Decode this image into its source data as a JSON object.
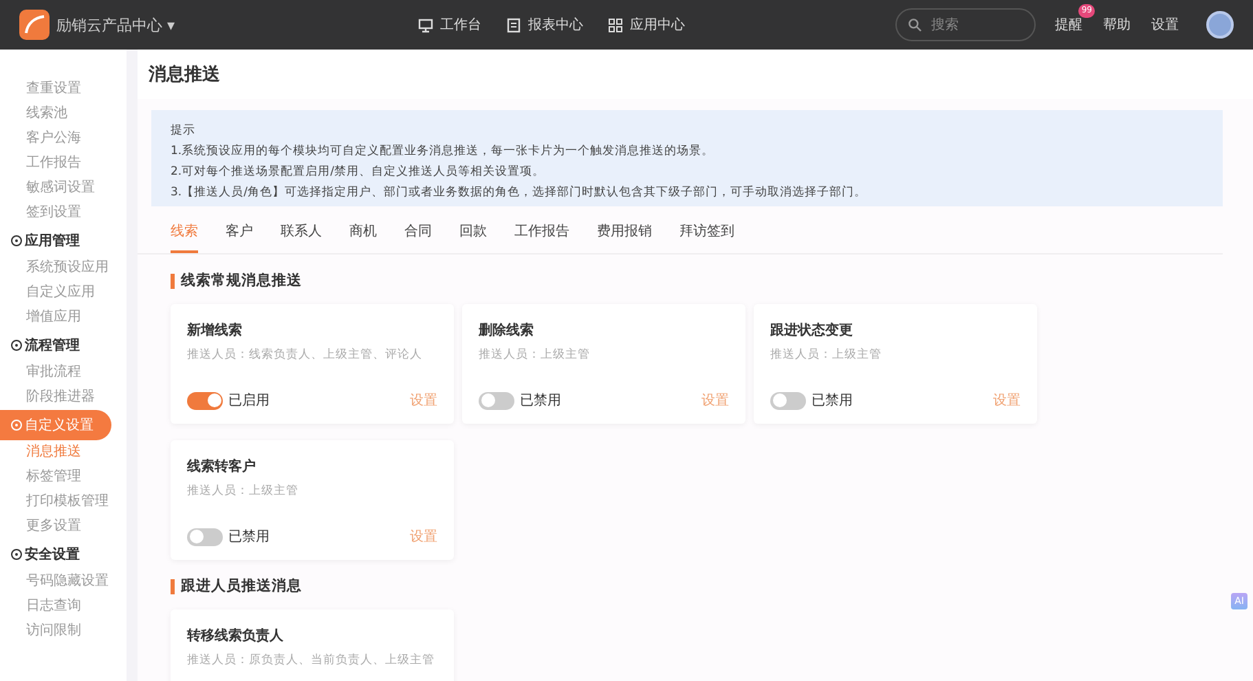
{
  "brand": {
    "name": "励销云产品中心",
    "caret": "▾"
  },
  "nav": [
    {
      "label": "工作台",
      "kind": "monitor"
    },
    {
      "label": "报表中心",
      "kind": "report"
    },
    {
      "label": "应用中心",
      "kind": "grid"
    }
  ],
  "search": {
    "placeholder": "搜索"
  },
  "header_links": [
    {
      "label": "提醒",
      "badge": "99"
    },
    {
      "label": "帮助"
    },
    {
      "label": "设置"
    }
  ],
  "sidebar": {
    "groups": [
      {
        "children": [
          {
            "label": "查重设置",
            "selected": false
          },
          {
            "label": "线索池",
            "selected": false
          },
          {
            "label": "客户公海",
            "selected": false
          },
          {
            "label": "工作报告",
            "selected": false
          },
          {
            "label": "敏感词设置",
            "selected": false
          },
          {
            "label": "签到设置",
            "selected": false
          }
        ]
      },
      {
        "label": "应用管理",
        "selected": false,
        "children": [
          {
            "label": "系统预设应用",
            "selected": false
          },
          {
            "label": "自定义应用",
            "selected": false
          },
          {
            "label": "增值应用",
            "selected": false
          }
        ]
      },
      {
        "label": "流程管理",
        "selected": false,
        "children": [
          {
            "label": "审批流程",
            "selected": false
          },
          {
            "label": "阶段推进器",
            "selected": false
          }
        ]
      },
      {
        "label": "自定义设置",
        "selected": true,
        "children": [
          {
            "label": "消息推送",
            "selected": true
          },
          {
            "label": "标签管理",
            "selected": false
          },
          {
            "label": "打印模板管理",
            "selected": false
          },
          {
            "label": "更多设置",
            "selected": false
          }
        ]
      },
      {
        "label": "安全设置",
        "selected": false,
        "children": [
          {
            "label": "号码隐藏设置",
            "selected": false
          },
          {
            "label": "日志查询",
            "selected": false
          },
          {
            "label": "访问限制",
            "selected": false
          }
        ]
      }
    ]
  },
  "page_title": "消息推送",
  "tip": {
    "title": "提示",
    "lines": [
      "1.系统预设应用的每个模块均可自定义配置业务消息推送，每一张卡片为一个触发消息推送的场景。",
      "2.可对每个推送场景配置启用/禁用、自定义推送人员等相关设置项。",
      "3.【推送人员/角色】可选择指定用户、部门或者业务数据的角色，选择部门时默认包含其下级子部门，可手动取消选择子部门。"
    ]
  },
  "tabs": [
    {
      "label": "线索",
      "selected": true
    },
    {
      "label": "客户",
      "selected": false
    },
    {
      "label": "联系人",
      "selected": false
    },
    {
      "label": "商机",
      "selected": false
    },
    {
      "label": "合同",
      "selected": false
    },
    {
      "label": "回款",
      "selected": false
    },
    {
      "label": "工作报告",
      "selected": false
    },
    {
      "label": "费用报销",
      "selected": false
    },
    {
      "label": "拜访签到",
      "selected": false
    }
  ],
  "sections": [
    {
      "title": "线索常规消息推送",
      "cards": [
        {
          "title": "新增线索",
          "recipients": "推送人员：线索负责人、上级主管、评论人",
          "on": true,
          "status": "已启用",
          "action": "设置"
        },
        {
          "title": "删除线索",
          "recipients": "推送人员：上级主管",
          "on": false,
          "status": "已禁用",
          "action": "设置"
        },
        {
          "title": "跟进状态变更",
          "recipients": "推送人员：上级主管",
          "on": false,
          "status": "已禁用",
          "action": "设置"
        },
        {
          "title": "线索转客户",
          "recipients": "推送人员：上级主管",
          "on": false,
          "status": "已禁用",
          "action": "设置"
        }
      ]
    },
    {
      "title": "跟进人员推送消息",
      "cards": [
        {
          "title": "转移线索负责人",
          "recipients": "推送人员：原负责人、当前负责人、上级主管"
        }
      ]
    }
  ],
  "ai_button": "AI"
}
